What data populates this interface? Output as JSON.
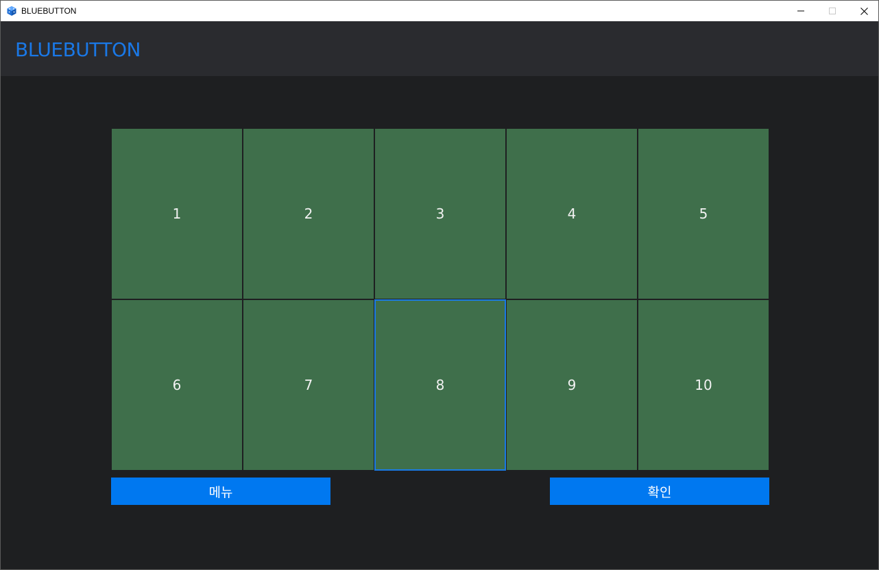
{
  "window": {
    "title": "BLUEBUTTON",
    "icon": "cube-app-icon"
  },
  "header": {
    "title": "BLUEBUTTON"
  },
  "grid": {
    "cells": [
      "1",
      "2",
      "3",
      "4",
      "5",
      "6",
      "7",
      "8",
      "9",
      "10"
    ],
    "selected_label": "8"
  },
  "actions": {
    "menu_label": "메뉴",
    "confirm_label": "확인"
  },
  "colors": {
    "accent": "#0078f0",
    "title_accent": "#1a78e6",
    "cell": "#3f6f4b",
    "background": "#1e1f21",
    "header": "#2a2b2f"
  }
}
